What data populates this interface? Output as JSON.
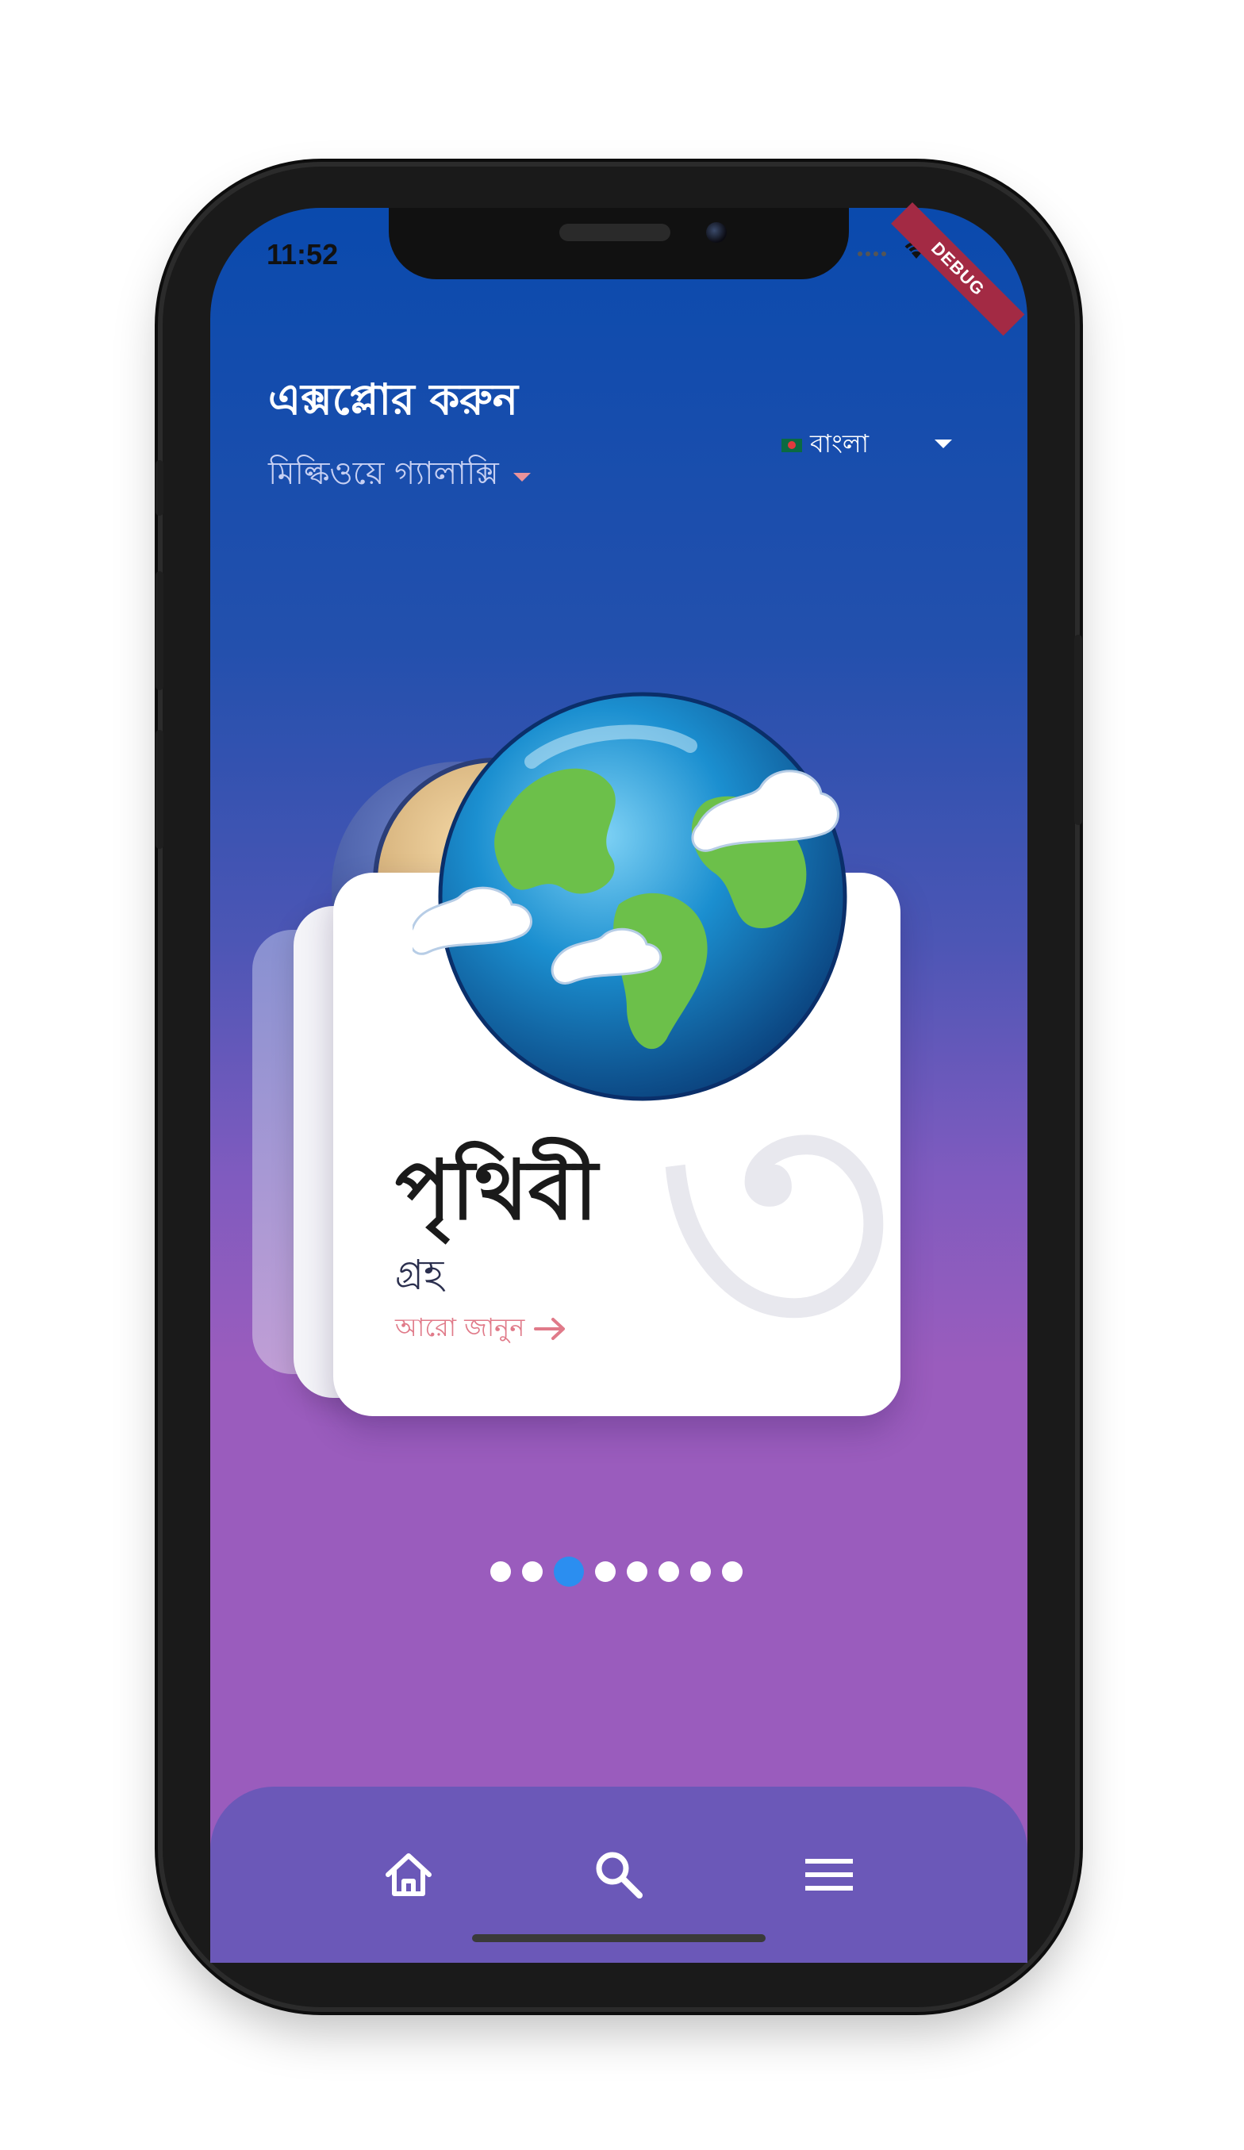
{
  "status_bar": {
    "time": "11:52",
    "debug_label": "DEBUG"
  },
  "header": {
    "title": "এক্সপ্লোর করুন",
    "galaxy_selector": "মিল্কিওয়ে গ্যালাক্সি",
    "language": {
      "selected": "বাংলা",
      "flag": "bangladesh-flag-icon"
    }
  },
  "card": {
    "name": "পৃথিবী",
    "type": "গ্রহ",
    "learn_more": "আরো জানুন",
    "position_numeral": "৩"
  },
  "pagination": {
    "total": 8,
    "active_index": 2
  },
  "bottom_nav": {
    "items": [
      "home-icon",
      "search-icon",
      "menu-icon"
    ]
  },
  "colors": {
    "gradient_top": "#0a4aad",
    "gradient_bottom": "#9a5cbd",
    "nav_bg": "#6b58b8",
    "accent_pink": "#e07a89",
    "dot_active": "#2b8ef0"
  }
}
